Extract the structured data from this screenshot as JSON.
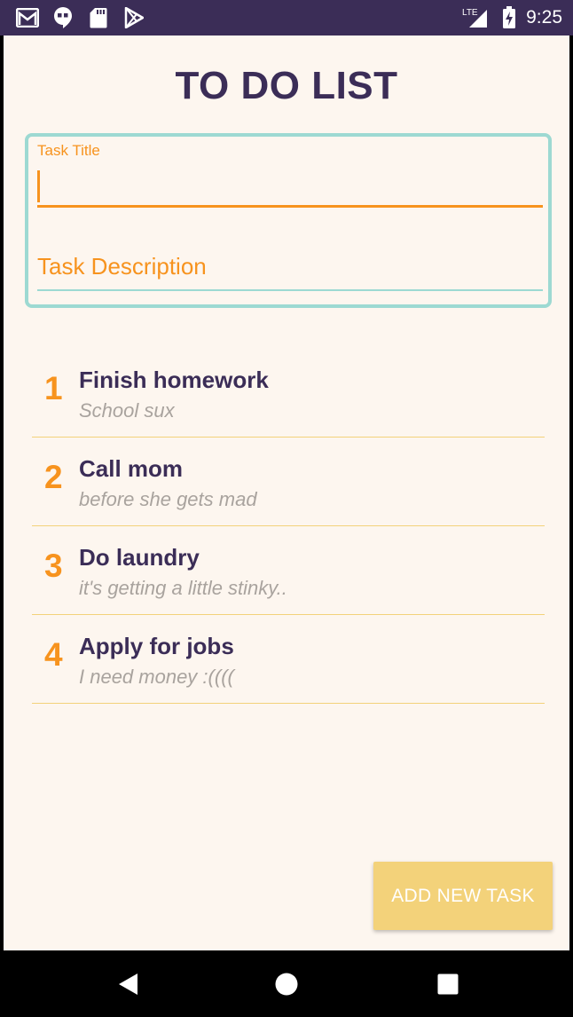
{
  "status_bar": {
    "icons_left": [
      "gmail-icon",
      "hangouts-icon",
      "sd-card-icon",
      "play-store-icon"
    ],
    "network_label": "LTE",
    "time": "9:25"
  },
  "app": {
    "title": "TO DO LIST"
  },
  "form": {
    "title_label": "Task Title",
    "title_value": "",
    "description_placeholder": "Task Description",
    "description_value": ""
  },
  "tasks": [
    {
      "number": "1",
      "title": "Finish homework",
      "description": "School sux"
    },
    {
      "number": "2",
      "title": "Call mom",
      "description": "before she gets mad"
    },
    {
      "number": "3",
      "title": "Do laundry",
      "description": "it's getting a little stinky.."
    },
    {
      "number": "4",
      "title": "Apply for jobs",
      "description": "I need money :(((("
    }
  ],
  "actions": {
    "add_label": "ADD NEW TASK"
  },
  "colors": {
    "primary": "#3b2d57",
    "accent": "#f7931e",
    "teal": "#9dd9d2",
    "button": "#f3d27a",
    "background": "#fdf6ef"
  }
}
